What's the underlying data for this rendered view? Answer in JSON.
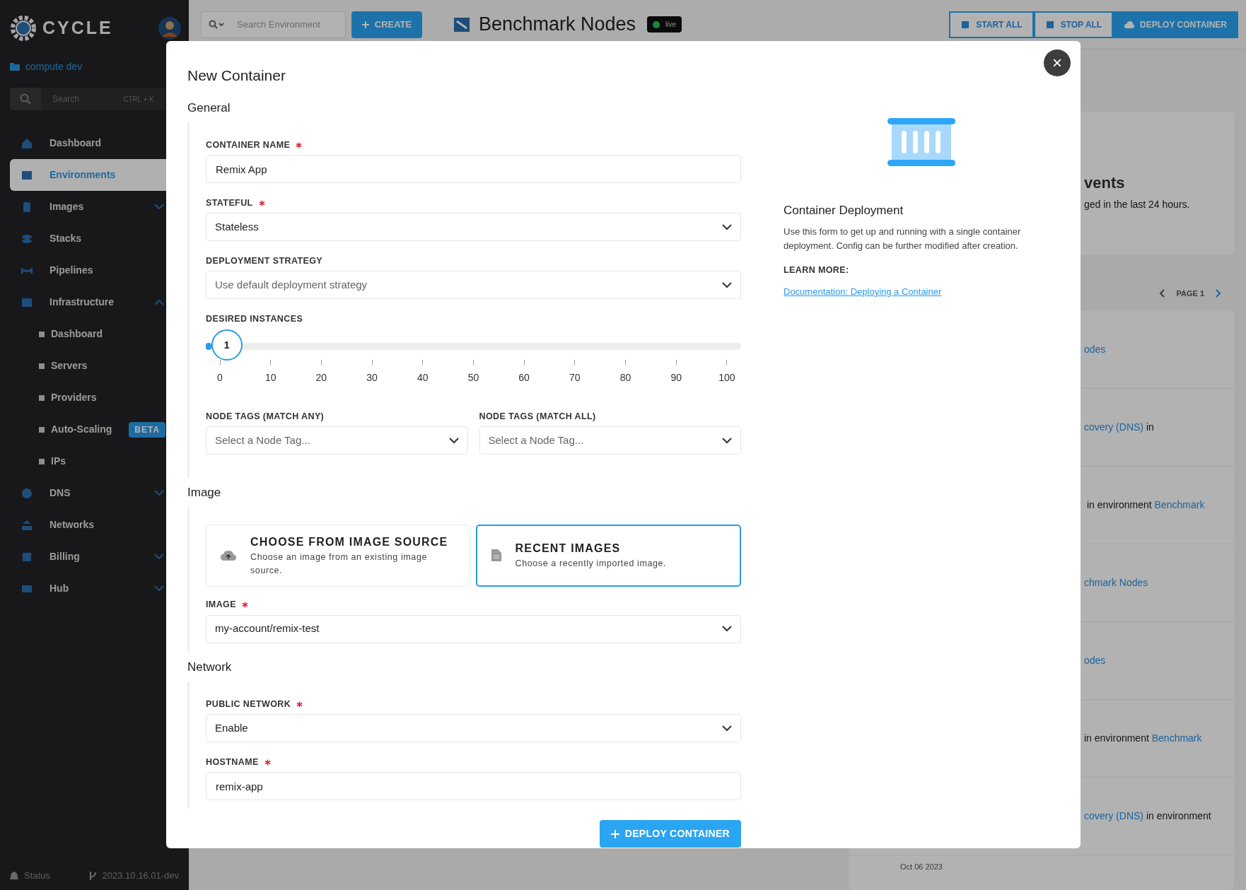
{
  "sidebar": {
    "logo": "CYCLE",
    "hub": "compute dev",
    "search": {
      "placeholder": "Search",
      "shortcut": "CTRL + K"
    },
    "items": [
      {
        "label": "Dashboard",
        "kind": "link",
        "selected": false
      },
      {
        "label": "Environments",
        "kind": "link",
        "selected": true
      },
      {
        "label": "Images",
        "kind": "group",
        "selected": false,
        "expanded": false
      },
      {
        "label": "Stacks",
        "kind": "link",
        "selected": false
      },
      {
        "label": "Pipelines",
        "kind": "link",
        "selected": false
      },
      {
        "label": "Infrastructure",
        "kind": "group",
        "selected": false,
        "expanded": true,
        "children": [
          {
            "label": "Dashboard"
          },
          {
            "label": "Servers"
          },
          {
            "label": "Providers"
          },
          {
            "label": "Auto-Scaling",
            "badge": "BETA"
          },
          {
            "label": "IPs"
          }
        ]
      },
      {
        "label": "DNS",
        "kind": "group",
        "selected": false,
        "expanded": false
      },
      {
        "label": "Networks",
        "kind": "link",
        "selected": false
      },
      {
        "label": "Billing",
        "kind": "group",
        "selected": false,
        "expanded": false
      },
      {
        "label": "Hub",
        "kind": "group",
        "selected": false,
        "expanded": false
      }
    ],
    "status": "Status",
    "version": "2023.10.16.01-dev"
  },
  "topbar": {
    "search_placeholder": "Search Environment",
    "create": "CREATE",
    "title": "Benchmark Nodes",
    "state": "live",
    "buttons": [
      {
        "label": "START ALL",
        "kind": "outline"
      },
      {
        "label": "STOP ALL",
        "kind": "outline"
      },
      {
        "label": "DEPLOY CONTAINER",
        "kind": "primary"
      }
    ]
  },
  "events": {
    "title": "vents",
    "subtitle": "ged in the last 24 hours.",
    "page": "PAGE 1",
    "rows": [
      {
        "parts": [
          {
            "text": "odes",
            "link": true
          }
        ]
      },
      {
        "parts": [
          {
            "text": "covery (DNS)",
            "link": true
          },
          {
            "text": " in",
            "link": false
          }
        ]
      },
      {
        "parts": [
          {
            "text": " in environment ",
            "link": false
          },
          {
            "text": "Benchmark",
            "link": true
          }
        ]
      },
      {
        "parts": [
          {
            "text": "chmark Nodes",
            "link": true
          }
        ]
      },
      {
        "parts": [
          {
            "text": "odes",
            "link": true
          }
        ]
      },
      {
        "parts": [
          {
            "text": "in environment ",
            "link": false
          },
          {
            "text": "Benchmark",
            "link": true
          }
        ]
      },
      {
        "parts": [
          {
            "text": "covery (DNS)",
            "link": true
          },
          {
            "text": " in environment",
            "link": false
          }
        ]
      }
    ],
    "date": "Oct 06 2023"
  },
  "modal": {
    "title": "New Container",
    "close": "×",
    "sections": [
      {
        "title": "General",
        "fields": [
          {
            "kind": "text",
            "label": "CONTAINER NAME",
            "required": true,
            "value": "Remix App"
          },
          {
            "kind": "select",
            "label": "STATEFUL",
            "required": true,
            "value": "Stateless"
          },
          {
            "kind": "select",
            "label": "DEPLOYMENT STRATEGY",
            "required": false,
            "placeholder": "Use default deployment strategy"
          },
          {
            "kind": "slider",
            "label": "DESIRED INSTANCES",
            "required": false,
            "value": "1",
            "level": 0.01,
            "ticks": [
              "0",
              "10",
              "20",
              "30",
              "40",
              "50",
              "60",
              "70",
              "80",
              "90",
              "100"
            ]
          },
          {
            "kind": "pair",
            "fields": [
              {
                "kind": "select",
                "label": "NODE TAGS (MATCH ANY)",
                "required": false,
                "placeholder": "Select a Node Tag..."
              },
              {
                "kind": "select",
                "label": "NODE TAGS (MATCH ALL)",
                "required": false,
                "placeholder": "Select a Node Tag..."
              }
            ]
          }
        ]
      },
      {
        "title": "Image",
        "fields": [
          {
            "kind": "options",
            "options": [
              {
                "title": "CHOOSE FROM IMAGE SOURCE",
                "description": "Choose an image from an existing image source.",
                "selected": false
              },
              {
                "title": "RECENT IMAGES",
                "description": "Choose a recently imported image.",
                "selected": true
              }
            ]
          },
          {
            "kind": "select",
            "label": "IMAGE",
            "required": true,
            "value": "my-account/remix-test"
          }
        ]
      },
      {
        "title": "Network",
        "fields": [
          {
            "kind": "select",
            "label": "PUBLIC NETWORK",
            "required": true,
            "value": "Enable"
          },
          {
            "kind": "text",
            "label": "HOSTNAME",
            "required": true,
            "value": "remix-app"
          }
        ]
      }
    ],
    "submit": "DEPLOY CONTAINER",
    "info": {
      "title": "Container Deployment",
      "text": "Use this form to get up and running with a single container deployment. Config can be further modified after creation.",
      "learn_more": "LEARN MORE:",
      "link": "Documentation: Deploying a Container"
    }
  }
}
